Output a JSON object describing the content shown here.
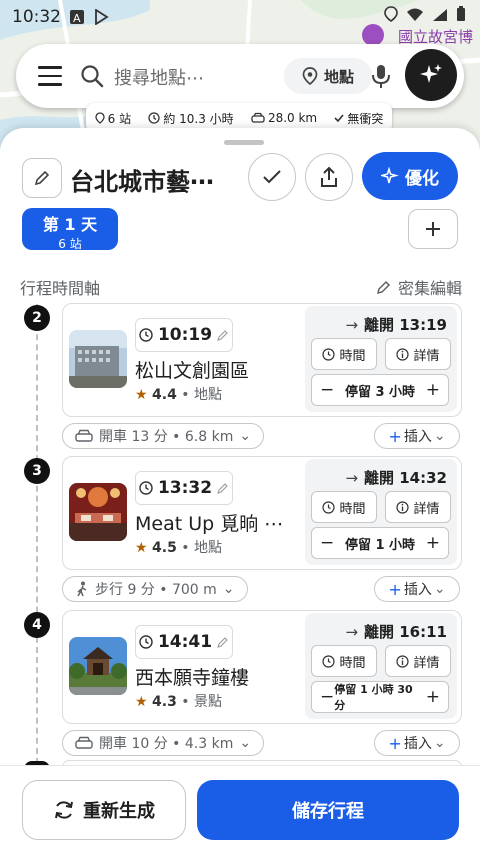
{
  "status_bar": {
    "time": "10:32"
  },
  "map": {
    "poi_label": "國立故宮博"
  },
  "search": {
    "placeholder": "搜尋地點⋯",
    "place_chip": "地點"
  },
  "summary": {
    "stops": "6 站",
    "duration": "約 10.3 小時",
    "distance": "28.0 km",
    "conflicts": "無衝突"
  },
  "trip": {
    "title": "台北城市藝⋯",
    "optimize_label": "優化",
    "day_label": "第 1 天",
    "day_stops": "6 站",
    "timeline_label": "行程時間軸",
    "dense_edit_label": "密集編輯"
  },
  "stops": [
    {
      "number": "2",
      "time": "10:19",
      "name": "松山文創園區",
      "rating": "4.4",
      "category": "地點",
      "depart": "離開 13:19",
      "time_btn": "時間",
      "detail_btn": "詳情",
      "stay": "停留 3 小時"
    },
    {
      "number": "3",
      "time": "13:32",
      "name": "Meat Up 覓晌 ⋯",
      "rating": "4.5",
      "category": "地點",
      "depart": "離開 14:32",
      "time_btn": "時間",
      "detail_btn": "詳情",
      "stay": "停留 1 小時"
    },
    {
      "number": "4",
      "time": "14:41",
      "name": "西本願寺鐘樓",
      "rating": "4.3",
      "category": "景點",
      "depart": "離開 16:11",
      "time_btn": "時間",
      "detail_btn": "詳情",
      "stay": "停留 1 小時 30 分"
    }
  ],
  "transits": [
    {
      "mode_icon": "car-icon",
      "text": "開車 13 分 • 6.8 km",
      "insert": "插入"
    },
    {
      "mode_icon": "walk-icon",
      "text": "步行 9 分 • 700 m",
      "insert": "插入"
    },
    {
      "mode_icon": "car-icon",
      "text": "開車 10 分 • 4.3 km",
      "insert": "插入"
    }
  ],
  "footer": {
    "regenerate_label": "重新生成",
    "save_label": "儲存行程"
  },
  "colors": {
    "accent": "#1a5ee8",
    "star": "#b06000",
    "dark": "#1d1d1d"
  }
}
